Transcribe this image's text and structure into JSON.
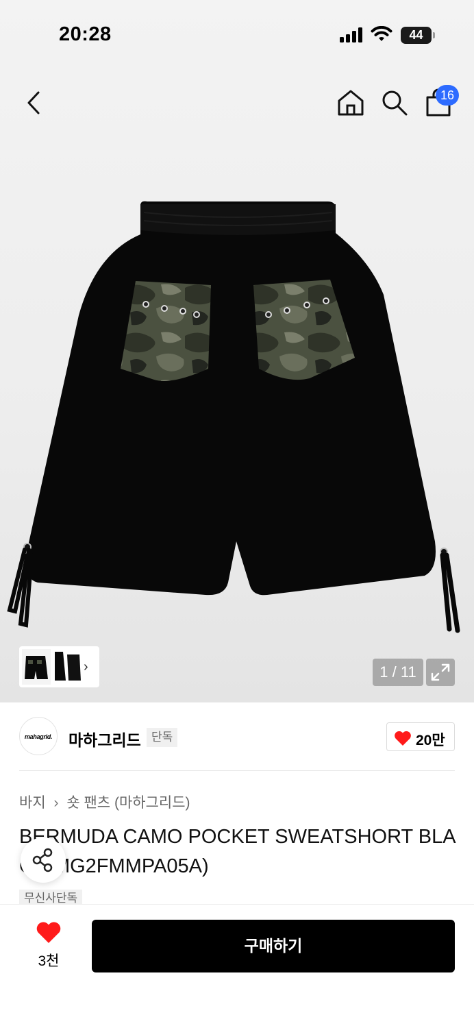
{
  "status_bar": {
    "time": "20:28",
    "battery": "44"
  },
  "header": {
    "cart_count": "16"
  },
  "gallery": {
    "counter": "1 / 11",
    "thumb_chevron": "›"
  },
  "brand": {
    "logo_text": "mahagrid.",
    "name": "마하그리드",
    "tag": "단독",
    "like_count": "20만"
  },
  "breadcrumb": [
    "바지",
    "숏 팬츠 (마하그리드)"
  ],
  "product": {
    "title": "BERMUDA CAMO POCKET SWEATSHORT BLACK(MG2FMMPA05A)",
    "tag": "무신사단독"
  },
  "bottom": {
    "wish_count": "3천",
    "buy_label": "구매하기"
  },
  "colors": {
    "badge": "#2d6bff",
    "heart": "#ff1a1a",
    "buy": "#000000"
  }
}
